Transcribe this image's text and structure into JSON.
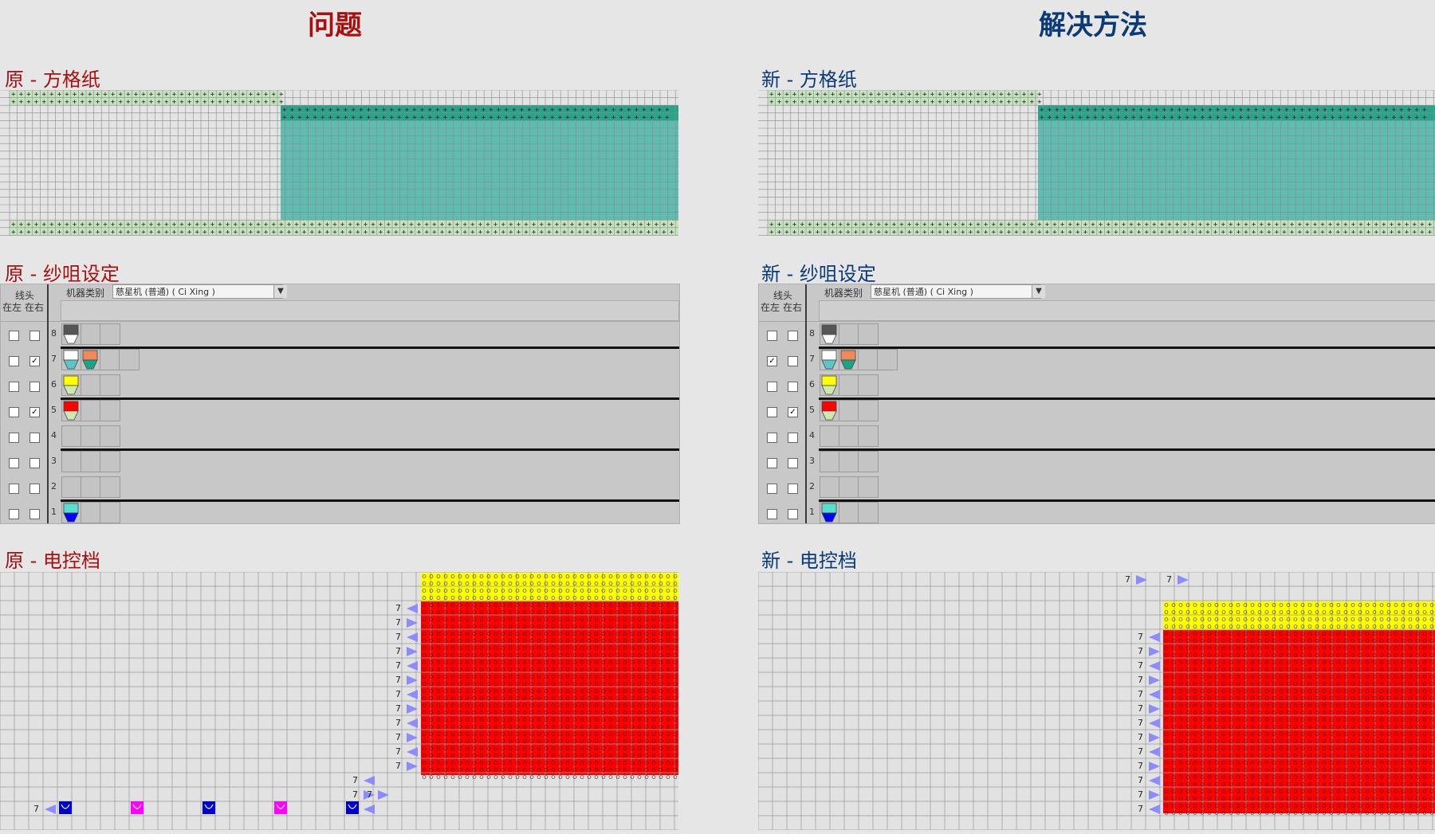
{
  "titles": {
    "problem": "问题",
    "solution": "解决方法"
  },
  "left": {
    "grid_title": "原 - 方格纸",
    "yarn_title": "原 - 纱咀设定",
    "ctrl_title": "原 - 电控档"
  },
  "right": {
    "grid_title": "新 - 方格纸",
    "yarn_title": "新 - 纱咀设定",
    "ctrl_title": "新 - 电控档"
  },
  "yarn_panel": {
    "header_line": "线头",
    "col_left": "在左",
    "col_right": "在右",
    "machine_type_label": "机器类别",
    "machine_type_value": "慈星机 (普通) ( Ci Xing )",
    "dropdown_icon": "chevron-down-icon"
  },
  "yarn_rows_left": [
    {
      "num": "8",
      "left": false,
      "right": false,
      "carriers": [
        {
          "top": "#555555",
          "bottom": "#ffffff"
        }
      ]
    },
    {
      "num": "7",
      "left": false,
      "right": true,
      "carriers": [
        {
          "top": "#ffffff",
          "bottom": "#5cc6c6"
        },
        {
          "top": "#f08a5a",
          "bottom": "#1aa58a"
        }
      ]
    },
    {
      "num": "6",
      "left": false,
      "right": false,
      "carriers": [
        {
          "top": "#ffff00",
          "bottom": "#cfe8b0"
        }
      ]
    },
    {
      "num": "5",
      "left": false,
      "right": true,
      "carriers": [
        {
          "top": "#ff0000",
          "bottom": "#cfe8b0"
        }
      ]
    },
    {
      "num": "4",
      "left": false,
      "right": false,
      "carriers": []
    },
    {
      "num": "3",
      "left": false,
      "right": false,
      "carriers": []
    },
    {
      "num": "2",
      "left": false,
      "right": false,
      "carriers": []
    },
    {
      "num": "1",
      "left": false,
      "right": false,
      "carriers": [
        {
          "top": "#55e0d0",
          "bottom": "#0000ff"
        }
      ]
    }
  ],
  "yarn_rows_right": [
    {
      "num": "8",
      "left": false,
      "right": false,
      "carriers": [
        {
          "top": "#555555",
          "bottom": "#ffffff"
        }
      ]
    },
    {
      "num": "7",
      "left": true,
      "right": false,
      "carriers": [
        {
          "top": "#ffffff",
          "bottom": "#5cc6c6"
        },
        {
          "top": "#f08a5a",
          "bottom": "#1aa58a"
        }
      ]
    },
    {
      "num": "6",
      "left": false,
      "right": false,
      "carriers": [
        {
          "top": "#ffff00",
          "bottom": "#cfe8b0"
        }
      ]
    },
    {
      "num": "5",
      "left": false,
      "right": true,
      "carriers": [
        {
          "top": "#ff0000",
          "bottom": "#cfe8b0"
        }
      ]
    },
    {
      "num": "4",
      "left": false,
      "right": false,
      "carriers": []
    },
    {
      "num": "3",
      "left": false,
      "right": false,
      "carriers": []
    },
    {
      "num": "2",
      "left": false,
      "right": false,
      "carriers": []
    },
    {
      "num": "1",
      "left": false,
      "right": false,
      "carriers": [
        {
          "top": "#55e0d0",
          "bottom": "#0000ff"
        }
      ]
    }
  ],
  "carrier_label": "7",
  "colors": {
    "problem_title": "#a80f0f",
    "solution_title": "#0b3a78",
    "knit_teal": "#5fbcb0",
    "knit_teal_top": "#26a58a",
    "rib_green": "#c6e3c0",
    "stitch_red": "#ff0000",
    "stitch_yellow": "#ffff00",
    "arrow_blue": "#8c8cff"
  }
}
